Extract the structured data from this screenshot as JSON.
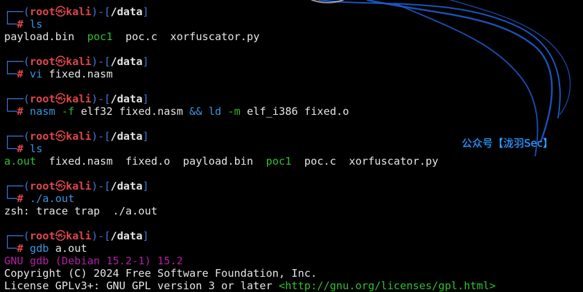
{
  "prompt": {
    "user": "root",
    "host": "kali",
    "path": "/data",
    "symbol": "#"
  },
  "blocks": [
    {
      "command": {
        "name": "ls",
        "args": []
      },
      "output": [
        [
          {
            "text": "payload.bin",
            "style": "plain"
          },
          {
            "text": "poc1",
            "style": "green"
          },
          {
            "text": "poc.c",
            "style": "plain"
          },
          {
            "text": "xorfuscator.py",
            "style": "plain"
          }
        ]
      ]
    },
    {
      "command": {
        "name": "vi",
        "args": [
          {
            "text": "fixed.nasm",
            "style": "arg"
          }
        ]
      },
      "output": []
    },
    {
      "command": {
        "name": "nasm",
        "args": [
          {
            "text": "-f",
            "style": "opt"
          },
          {
            "text": "elf32",
            "style": "arg"
          },
          {
            "text": "fixed.nasm",
            "style": "arg"
          },
          {
            "text": "&&",
            "style": "amp"
          },
          {
            "text": "ld",
            "style": "cmd"
          },
          {
            "text": "-m",
            "style": "opt"
          },
          {
            "text": "elf_i386",
            "style": "arg"
          },
          {
            "text": "fixed.o",
            "style": "arg"
          }
        ]
      },
      "output": []
    },
    {
      "command": {
        "name": "ls",
        "args": []
      },
      "output": [
        [
          {
            "text": "a.out",
            "style": "green"
          },
          {
            "text": "fixed.nasm",
            "style": "plain"
          },
          {
            "text": "fixed.o",
            "style": "plain"
          },
          {
            "text": "payload.bin",
            "style": "plain"
          },
          {
            "text": "poc1",
            "style": "green"
          },
          {
            "text": "poc.c",
            "style": "plain"
          },
          {
            "text": "xorfuscator.py",
            "style": "plain"
          }
        ]
      ]
    },
    {
      "command": {
        "name": "./a.out",
        "args": []
      },
      "output": [
        [
          {
            "text": "zsh: trace trap  ./a.out",
            "style": "plain"
          }
        ]
      ]
    },
    {
      "command": {
        "name": "gdb",
        "args": [
          {
            "text": "a.out",
            "style": "arg"
          }
        ]
      },
      "output": [
        [
          {
            "text": "GNU gdb (Debian 15.2-1) 15.2",
            "style": "magenta"
          }
        ],
        [
          {
            "text": "Copyright (C) 2024 Free Software Foundation, Inc.",
            "style": "plain"
          }
        ],
        [
          {
            "text": "License GPLv3+: GNU GPL version 3 or later ",
            "style": "plain"
          },
          {
            "text": "<http://gnu.org/licenses/gpl.html>",
            "style": "url"
          }
        ]
      ]
    }
  ],
  "watermark": "公众号【泷羽Sec】",
  "colors": {
    "background": "#000000",
    "prompt_box": "#3a78d8",
    "prompt_user": "#e0474e",
    "command": "#3c95e0",
    "option": "#2fb52f",
    "executable": "#2ec22e",
    "gdb_banner": "#b51ea6"
  }
}
